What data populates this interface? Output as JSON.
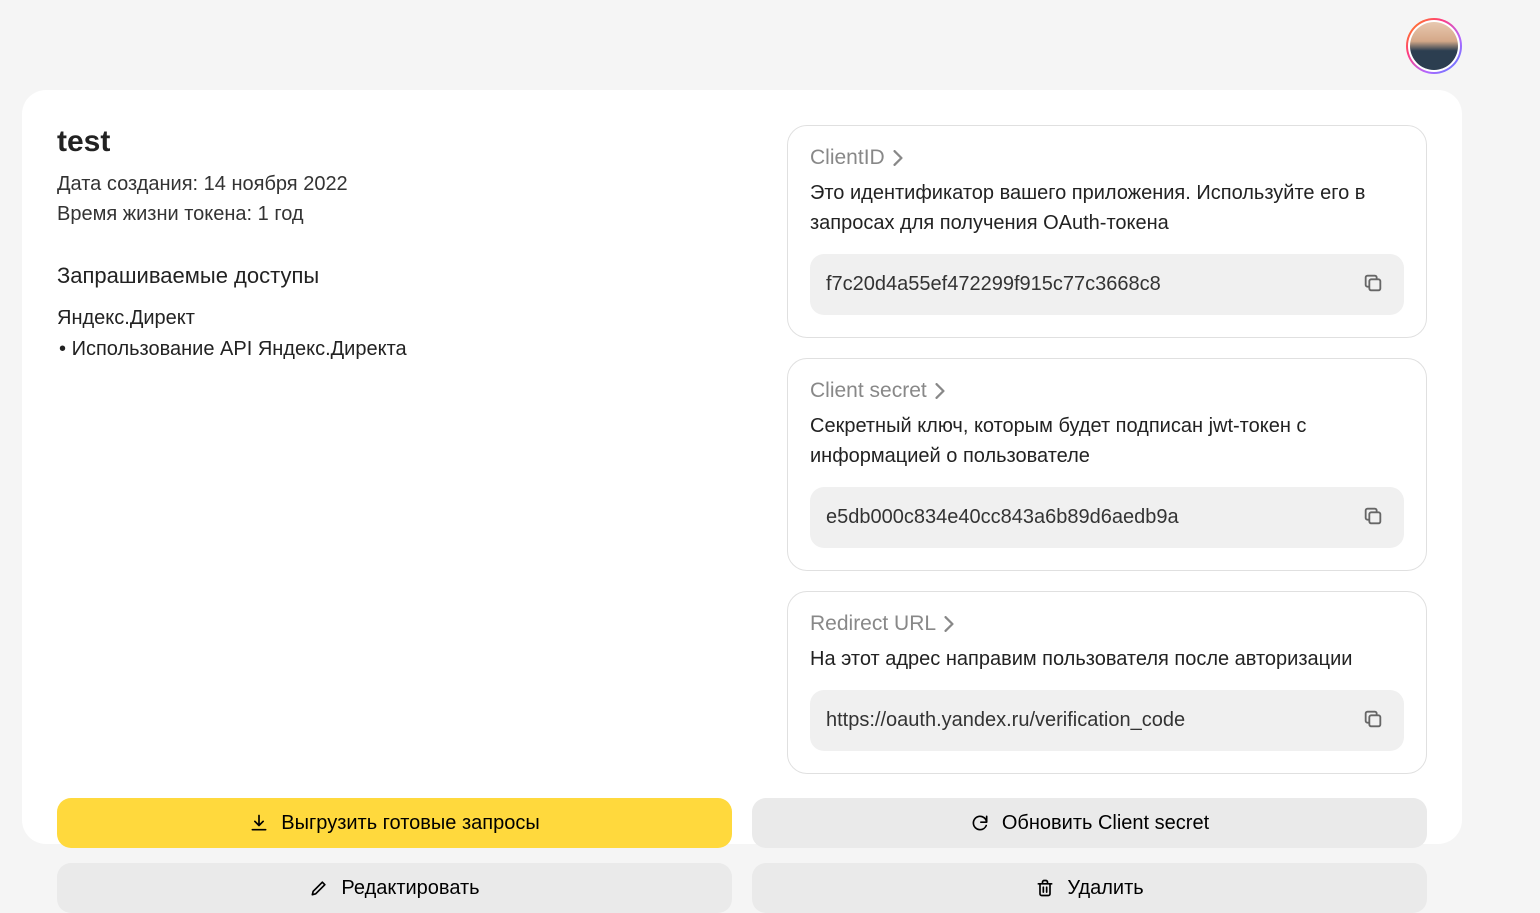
{
  "app": {
    "name": "test",
    "created_label": "Дата создания: 14 ноября 2022",
    "lifetime_label": "Время жизни токена: 1 год"
  },
  "permissions": {
    "title": "Запрашиваемые доступы",
    "service": "Яндекс.Директ",
    "item": "Использование API Яндекс.Директа"
  },
  "blocks": {
    "client_id": {
      "title": "ClientID",
      "desc": "Это идентификатор вашего приложения. Используйте его в запросах для получения OAuth-токена",
      "value": "f7c20d4a55ef472299f915c77c3668c8"
    },
    "client_secret": {
      "title": "Client secret",
      "desc": "Секретный ключ, которым будет подписан jwt-токен с информацией о пользователе",
      "value": "e5db000c834e40cc843a6b89d6aedb9a"
    },
    "redirect": {
      "title": "Redirect URL",
      "desc": "На этот адрес направим пользователя после авторизации",
      "value": "https://oauth.yandex.ru/verification_code"
    }
  },
  "actions": {
    "export": "Выгрузить готовые запросы",
    "edit": "Редактировать",
    "refresh": "Обновить Client secret",
    "delete": "Удалить"
  }
}
